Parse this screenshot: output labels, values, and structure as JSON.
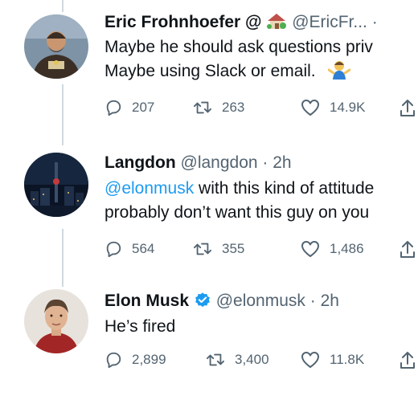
{
  "tweets": [
    {
      "name": "Eric Frohnhoefer",
      "name_suffix": "@",
      "handle": "@EricFr...",
      "separator": "·",
      "time": "",
      "body_line1": "Maybe he should ask questions priv",
      "body_line2": "Maybe using Slack or email.",
      "body_line2_emoji": "person-shrugging-emoji",
      "header_emoji": "house-with-garden-emoji",
      "replies": "207",
      "retweets": "263",
      "likes": "14.9K"
    },
    {
      "name": "Langdon",
      "handle": "@langdon",
      "separator": "·",
      "time": "2h",
      "mention": "@elonmusk",
      "body_line1_rest": " with this kind of attitude",
      "body_line2": "probably don’t want this guy on you",
      "replies": "564",
      "retweets": "355",
      "likes": "1,486"
    },
    {
      "name": "Elon Musk",
      "verified": "verified-badge-icon",
      "handle": "@elonmusk",
      "separator": "·",
      "time": "2h",
      "body_line1": "He’s fired",
      "replies": "2,899",
      "retweets": "3,400",
      "likes": "11.8K"
    }
  ],
  "colors": {
    "text": "#0f1419",
    "secondary": "#536471",
    "link": "#1d9bf0",
    "verified": "#1d9bf0",
    "thread_line": "#cfd9de"
  }
}
